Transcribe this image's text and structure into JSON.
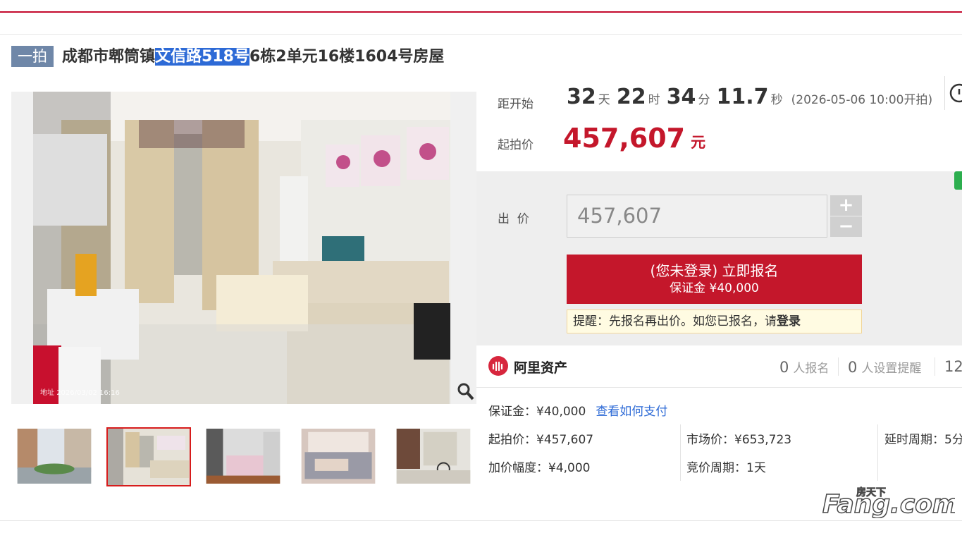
{
  "title": {
    "badge": "一拍",
    "prefix": "成都市郫筒镇",
    "highlight": "文信路518号",
    "suffix": "6栋2单元16楼1604号房屋"
  },
  "photo": {
    "timestamp": "2026/03/02 16:16",
    "timestamp_prefix": "地址"
  },
  "countdown": {
    "label": "距开始",
    "days": "32",
    "days_unit": "天",
    "hours": "22",
    "hours_unit": "时",
    "minutes": "34",
    "minutes_unit": "分",
    "seconds": "11.7",
    "seconds_unit": "秒",
    "start_note": "(2026-05-06 10:00开拍)"
  },
  "start_price": {
    "label": "起拍价",
    "value": "457,607",
    "unit": "元"
  },
  "bid": {
    "label": "出  价",
    "input_value": "457,607",
    "plus": "+",
    "minus": "−",
    "register_line1": "(您未登录) 立即报名",
    "register_line2": "保证金 ¥40,000",
    "tip_text": "提醒：先报名再出价。如您已报名，请",
    "tip_link": "登录"
  },
  "platform": {
    "name": "阿里资产",
    "signups_count": "0",
    "signups_label": "人报名",
    "reminders_count": "0",
    "reminders_label": "人设置提醒",
    "views_count": "12"
  },
  "details": {
    "deposit": "保证金：¥40,000",
    "deposit_link": "查看如何支付",
    "start_price": "起拍价：¥457,607",
    "market_price": "市场价：¥653,723",
    "delay": "延时周期：5分",
    "increment": "加价幅度：¥4,000",
    "bid_cycle": "竞价周期：1天"
  },
  "colors": {
    "accent_red": "#c4172b",
    "badge_blue": "#6f87a8",
    "link_blue": "#2d6ad6"
  }
}
